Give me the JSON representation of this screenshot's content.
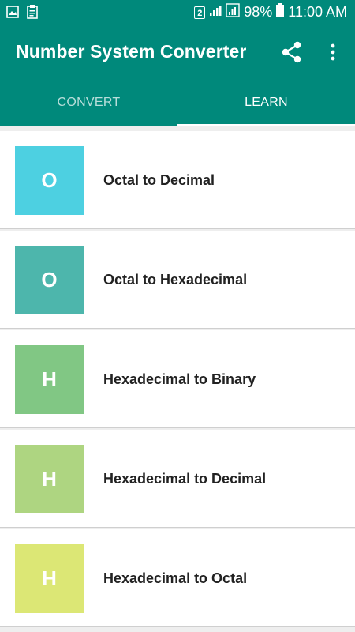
{
  "status_bar": {
    "sim_slot": "2",
    "battery": "98%",
    "time": "11:00 AM"
  },
  "app_bar": {
    "title": "Number System Converter"
  },
  "tabs": [
    {
      "label": "CONVERT"
    },
    {
      "label": "LEARN"
    }
  ],
  "items": [
    {
      "letter": "O",
      "title": "Octal to Decimal",
      "color": "#4dd0e1"
    },
    {
      "letter": "O",
      "title": "Octal to Hexadecimal",
      "color": "#4db6ac"
    },
    {
      "letter": "H",
      "title": "Hexadecimal to Binary",
      "color": "#81c784"
    },
    {
      "letter": "H",
      "title": "Hexadecimal to Decimal",
      "color": "#aed581"
    },
    {
      "letter": "H",
      "title": "Hexadecimal to Octal",
      "color": "#dce775"
    }
  ],
  "colors": {
    "primary": "#00897b"
  }
}
